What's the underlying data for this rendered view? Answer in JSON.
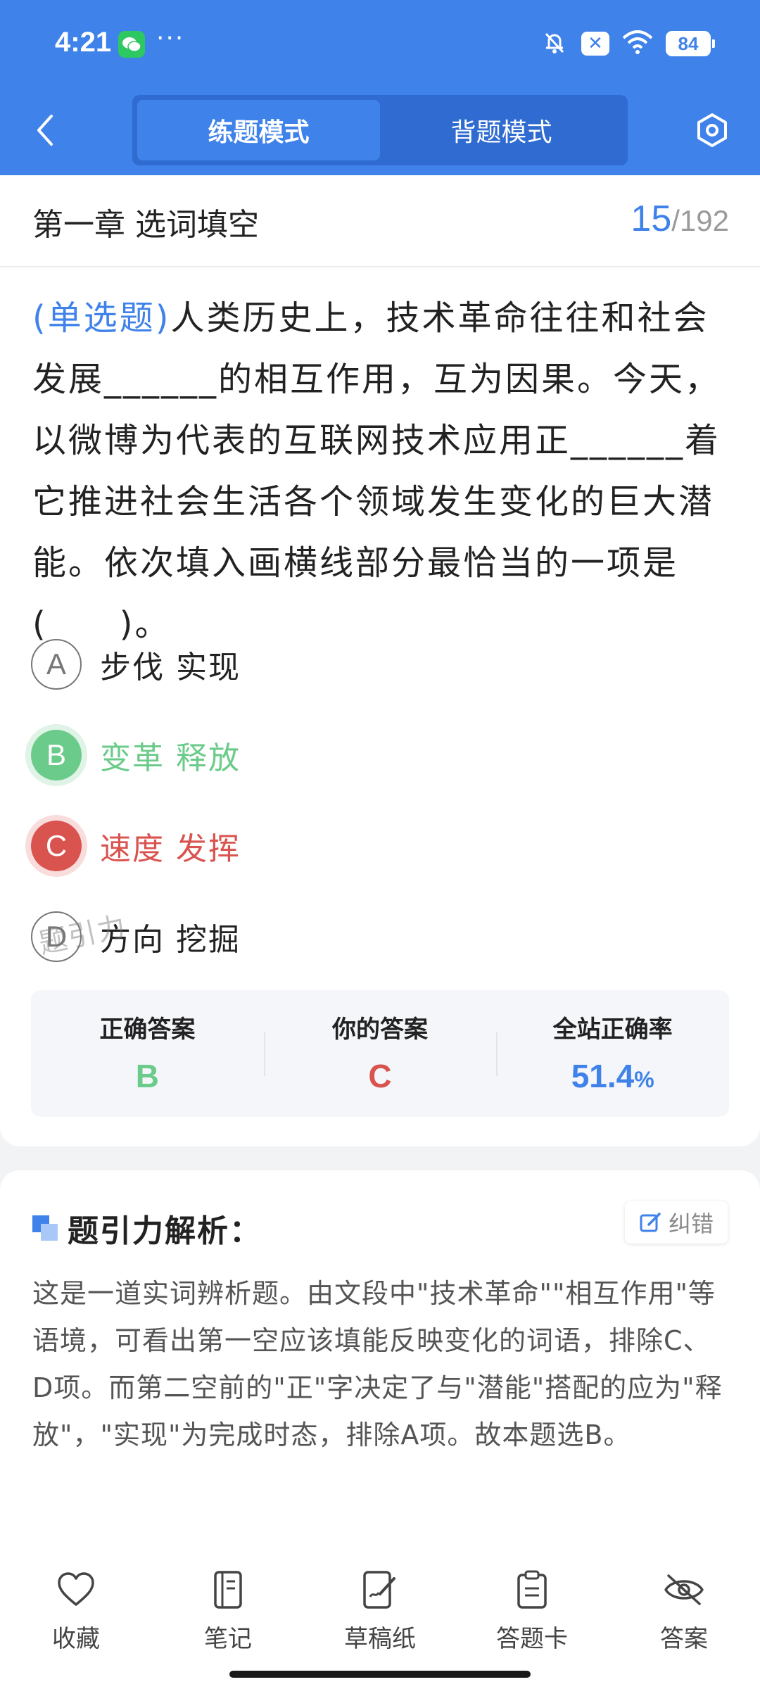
{
  "status_bar": {
    "time": "4:21",
    "more": "···",
    "battery": "84"
  },
  "nav": {
    "tabs": [
      {
        "label": "练题模式",
        "active": true
      },
      {
        "label": "背题模式",
        "active": false
      }
    ]
  },
  "header": {
    "chapter": "第一章 选词填空",
    "current": "15",
    "total": "/192"
  },
  "question": {
    "type": "(单选题)",
    "text": "人类历史上，技术革命往往和社会发展______的相互作用，互为因果。今天，以微博为代表的互联网技术应用正______着它推进社会生活各个领域发生变化的巨大潜能。依次填入画横线部分最恰当的一项是(　　)。"
  },
  "options": [
    {
      "letter": "A",
      "text": "步伐 实现",
      "state": "normal"
    },
    {
      "letter": "B",
      "text": "变革 释放",
      "state": "correct"
    },
    {
      "letter": "C",
      "text": "速度 发挥",
      "state": "wrong"
    },
    {
      "letter": "D",
      "text": "方向 挖掘",
      "state": "normal"
    }
  ],
  "watermark": "题引力",
  "stats": {
    "correct_label": "正确答案",
    "correct_value": "B",
    "yours_label": "你的答案",
    "yours_value": "C",
    "rate_label": "全站正确率",
    "rate_value": "51.4",
    "rate_unit": "%"
  },
  "analysis": {
    "title": "题引力解析：",
    "report_label": "纠错",
    "text": "这是一道实词辨析题。由文段中\"技术革命\"\"相互作用\"等语境，可看出第一空应该填能反映变化的词语，排除C、D项。而第二空前的\"正\"字决定了与\"潜能\"搭配的应为\"释放\"，\"实现\"为完成时态，排除A项。故本题选B。"
  },
  "bottom_tabs": [
    {
      "label": "收藏",
      "icon": "heart-icon"
    },
    {
      "label": "笔记",
      "icon": "notebook-icon"
    },
    {
      "label": "草稿纸",
      "icon": "draft-icon"
    },
    {
      "label": "答题卡",
      "icon": "answer-card-icon"
    },
    {
      "label": "答案",
      "icon": "eye-off-icon"
    }
  ],
  "colors": {
    "primary": "#3f82ea",
    "correct": "#6bcb8a",
    "wrong": "#d9534f"
  }
}
